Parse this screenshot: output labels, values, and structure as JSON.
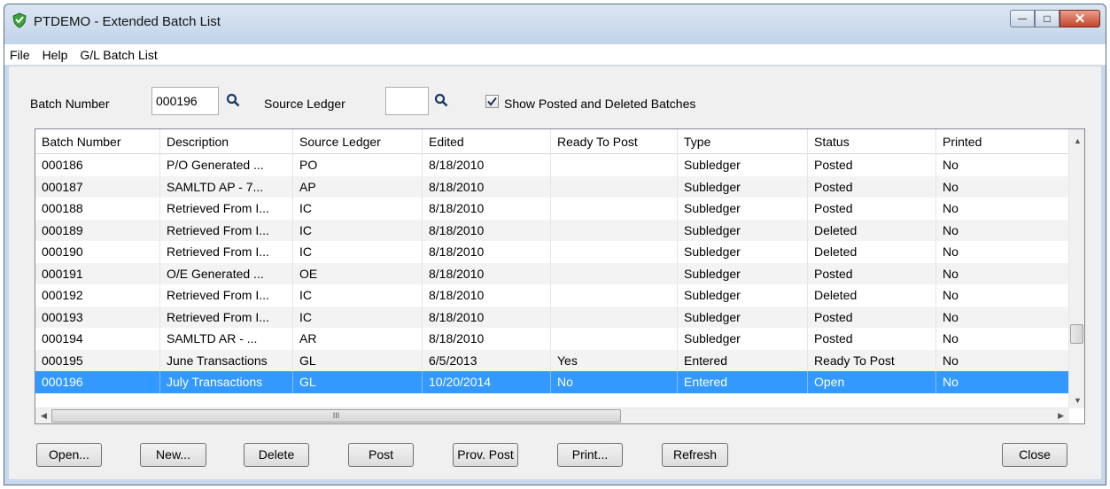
{
  "window": {
    "title": "PTDEMO - Extended Batch List",
    "minimize_glyph": "—",
    "maximize_glyph": "□",
    "close_glyph": "✕"
  },
  "menu": [
    "File",
    "Help",
    "G/L Batch List"
  ],
  "filters": {
    "batch_number_label": "Batch Number",
    "batch_number_value": "000196",
    "source_ledger_label": "Source Ledger",
    "source_ledger_value": "",
    "show_posted_label": "Show Posted and Deleted Batches",
    "show_posted_checked": true
  },
  "table": {
    "columns": [
      "Batch Number",
      "Description",
      "Source Ledger",
      "Edited",
      "Ready To Post",
      "Type",
      "Status",
      "Printed"
    ],
    "rows": [
      [
        "000186",
        "P/O Generated ...",
        "PO",
        "8/18/2010",
        "",
        "Subledger",
        "Posted",
        "No"
      ],
      [
        "000187",
        "SAMLTD AP - 7...",
        "AP",
        "8/18/2010",
        "",
        "Subledger",
        "Posted",
        "No"
      ],
      [
        "000188",
        "Retrieved From I...",
        "IC",
        "8/18/2010",
        "",
        "Subledger",
        "Posted",
        "No"
      ],
      [
        "000189",
        "Retrieved From I...",
        "IC",
        "8/18/2010",
        "",
        "Subledger",
        "Deleted",
        "No"
      ],
      [
        "000190",
        "Retrieved From I...",
        "IC",
        "8/18/2010",
        "",
        "Subledger",
        "Deleted",
        "No"
      ],
      [
        "000191",
        "O/E Generated ...",
        "OE",
        "8/18/2010",
        "",
        "Subledger",
        "Posted",
        "No"
      ],
      [
        "000192",
        "Retrieved From I...",
        "IC",
        "8/18/2010",
        "",
        "Subledger",
        "Deleted",
        "No"
      ],
      [
        "000193",
        "Retrieved From I...",
        "IC",
        "8/18/2010",
        "",
        "Subledger",
        "Posted",
        "No"
      ],
      [
        "000194",
        "SAMLTD AR - ...",
        "AR",
        "8/18/2010",
        "",
        "Subledger",
        "Posted",
        "No"
      ],
      [
        "000195",
        "June Transactions",
        "GL",
        "6/5/2013",
        "Yes",
        "Entered",
        "Ready To Post",
        "No"
      ],
      [
        "000196",
        "July Transactions",
        "GL",
        "10/20/2014",
        "No",
        "Entered",
        "Open",
        "No"
      ]
    ],
    "selected_row": 10,
    "hscroll_grip": "III"
  },
  "buttons": [
    "Open...",
    "New...",
    "Delete",
    "Post",
    "Prov. Post",
    "Print...",
    "Refresh",
    "Close"
  ],
  "colors": {
    "selection": "#3399ff",
    "titlebar": "#c2d4ea",
    "close_button": "#c4462c"
  }
}
